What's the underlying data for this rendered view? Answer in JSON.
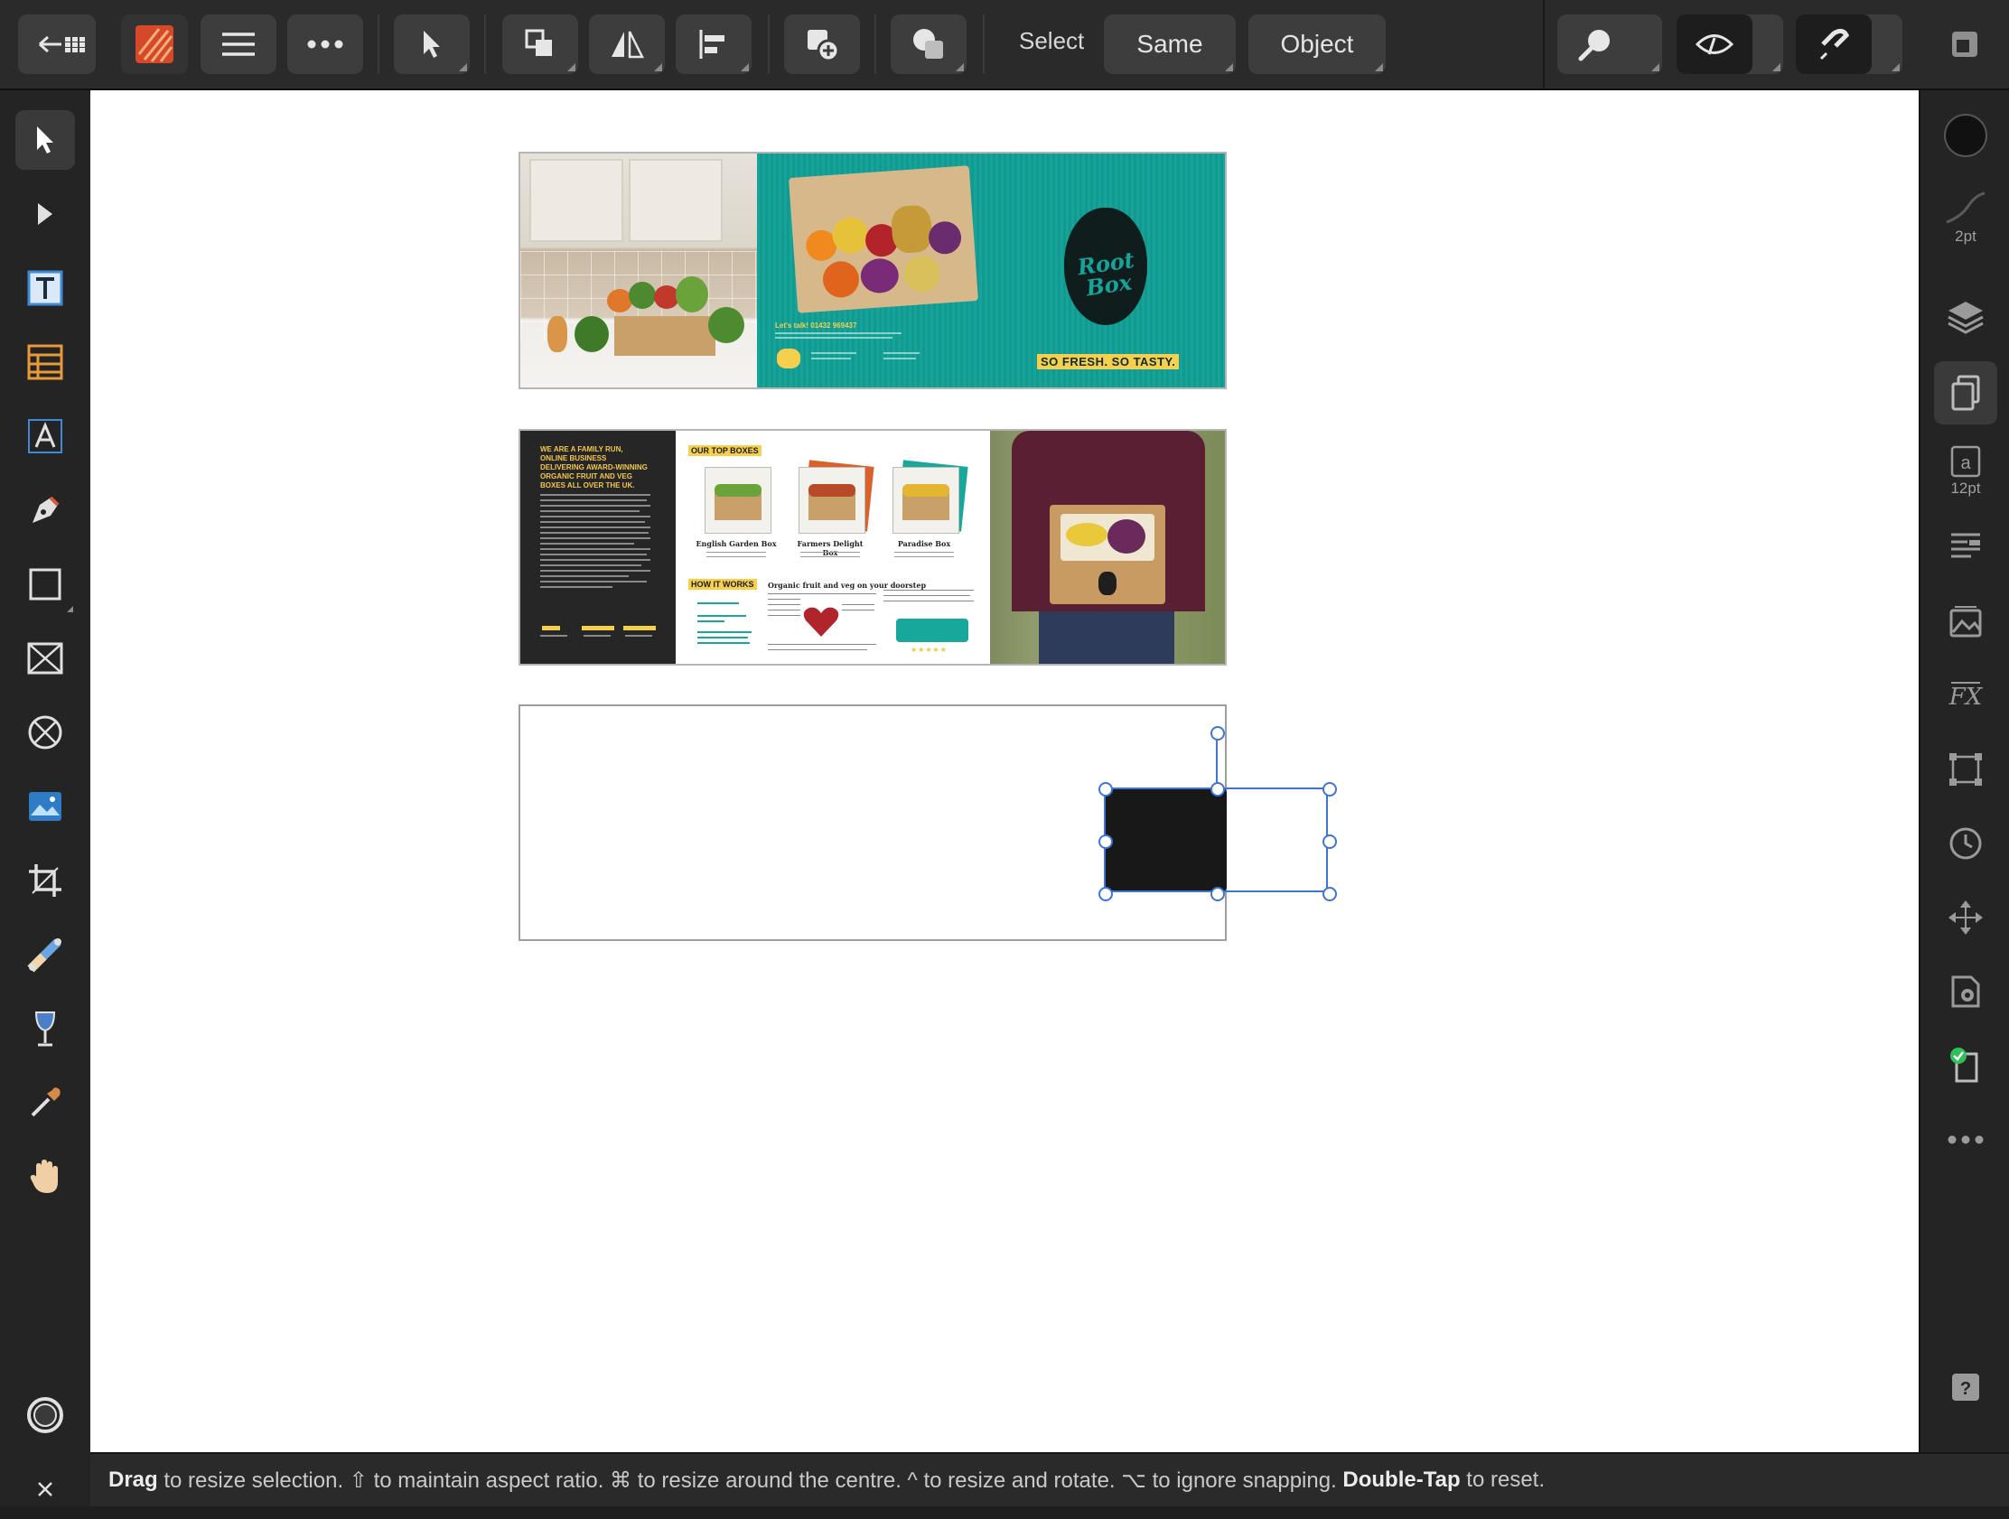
{
  "toolbar": {
    "select_label": "Select",
    "same_label": "Same",
    "object_label": "Object"
  },
  "right_panel": {
    "stroke_width_label": "2pt",
    "font_size_label": "12pt"
  },
  "document": {
    "spread1": {
      "logo_line1": "Root",
      "logo_line2": "Box",
      "tagline": "SO FRESH. SO TASTY.",
      "lets_talk": "Let's talk! 01432 969437"
    },
    "spread2": {
      "intro_heading": "WE ARE A FAMILY RUN, ONLINE BUSINESS DELIVERING AWARD-WINNING ORGANIC FRUIT AND VEG BOXES ALL OVER THE UK.",
      "top_boxes_heading": "OUR TOP BOXES",
      "box_names": [
        "English Garden Box",
        "Farmers Delight Box",
        "Paradise Box"
      ],
      "how_it_works": "HOW IT WORKS",
      "organic_heading": "Organic fruit and veg on your doorstep"
    }
  },
  "status_bar": {
    "s1": "Drag",
    "s2": " to resize selection. ⇧ to maintain aspect ratio. ⌘ to resize around the centre. ^ to resize and rotate. ⌥ to ignore snapping. ",
    "s3": "Double-Tap",
    "s4": " to reset."
  },
  "colors": {
    "accent": "#3f74d4",
    "brand_teal": "#15a39a",
    "brand_yellow": "#f6d04d"
  }
}
